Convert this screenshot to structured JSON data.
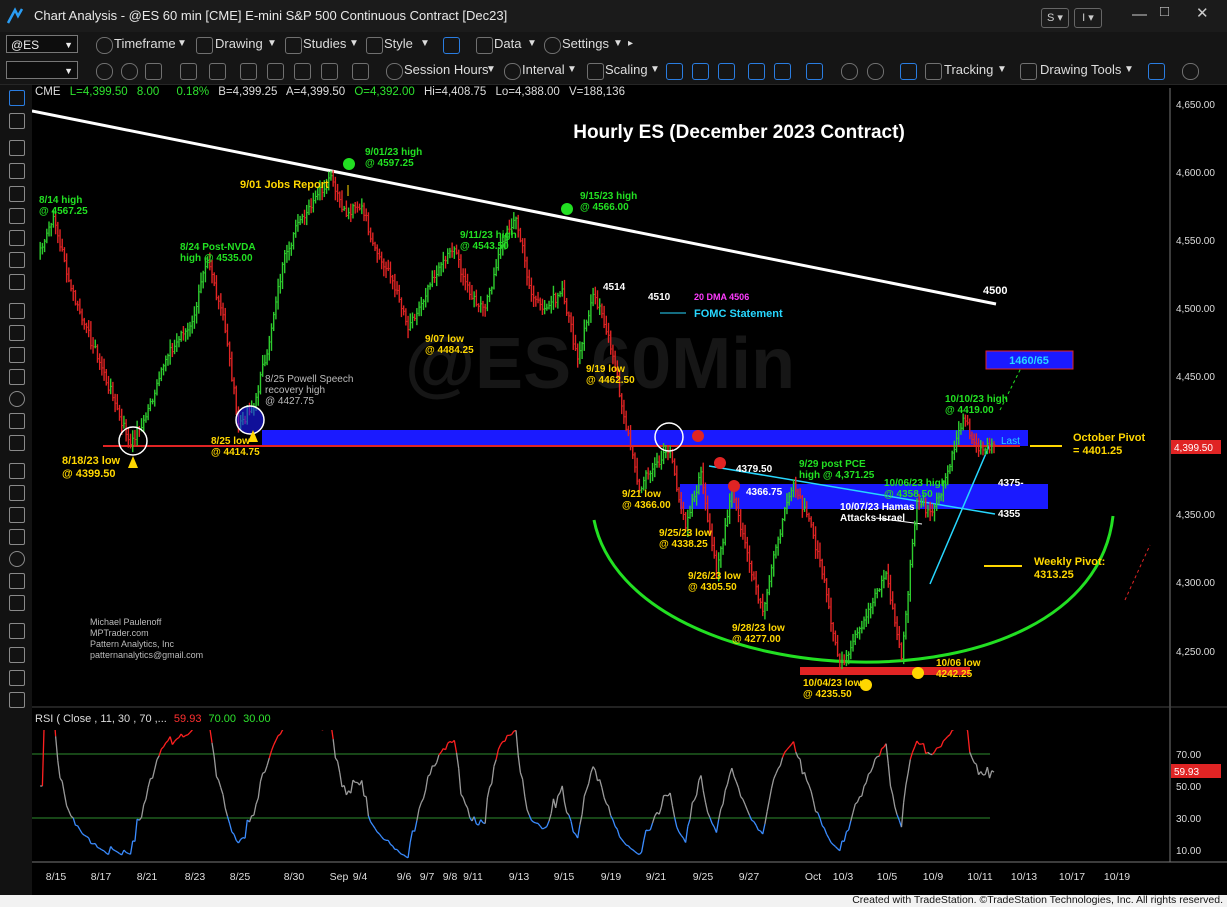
{
  "app": {
    "window_title": "Chart Analysis - @ES 60 min [CME] E-mini S&P 500 Continuous Contract [Dec23]",
    "win_buttons": [
      "S",
      "I"
    ],
    "footer": "Created with TradeStation. ©TradeStation Technologies, Inc. All rights reserved."
  },
  "toolbar1": {
    "symbol": "@ES",
    "items": [
      "Timeframe",
      "Drawing",
      "Studies",
      "Style",
      "Data",
      "Settings"
    ]
  },
  "toolbar2": {
    "items": [
      "Session Hours",
      "Interval",
      "Scaling",
      "Tracking",
      "Drawing Tools"
    ]
  },
  "quote_line": {
    "exchange": "CME",
    "last": "L=4,399.50",
    "change": "8.00",
    "pct": "0.18%",
    "bid": "B=4,399.25",
    "ask": "A=4,399.50",
    "open": "O=4,392.00",
    "high": "Hi=4,408.75",
    "low": "Lo=4,388.00",
    "volume": "V=188,136"
  },
  "colors": {
    "up_bar": "#2ecc2e",
    "down_bar": "#e02424",
    "trend_white": "#ffffff",
    "zone_blue": "#1a1aff",
    "support_red": "#e02424",
    "arc_green": "#22e022",
    "label_yellow": "#ffd700",
    "label_green": "#22e022",
    "label_cyan": "#27d7ff",
    "rsi_gray": "#9a9a9a",
    "rsi_red": "#ff2020",
    "rsi_blue": "#3b8cff"
  },
  "watermark": "@ES 60Min",
  "chart_data": {
    "type": "line",
    "title": "Hourly ES (December 2023 Contract)",
    "symbol": "@ES",
    "interval": "60 min",
    "ylim": [
      4205,
      4665
    ],
    "y_ticks": [
      "4,650.00",
      "4,600.00",
      "4,550.00",
      "4,500.00",
      "4,450.00",
      "4,350.00",
      "4,300.00",
      "4,250.00"
    ],
    "last_price_tag": "4,399.50",
    "x_ticks": [
      "8/15",
      "8/17",
      "8/21",
      "8/23",
      "8/25",
      "8/30",
      "Sep",
      "9/4",
      "9/6",
      "9/7",
      "9/8",
      "9/11",
      "9/13",
      "9/15",
      "9/19",
      "9/21",
      "9/25",
      "9/27",
      "Oct",
      "10/3",
      "10/5",
      "10/9",
      "10/11",
      "10/13",
      "10/17",
      "10/19"
    ],
    "series": [
      {
        "name": "@ES",
        "points": [
          [
            "8/14",
            4540
          ],
          [
            "8/14",
            4567.25
          ],
          [
            "8/15",
            4520
          ],
          [
            "8/15",
            4488
          ],
          [
            "8/16",
            4460
          ],
          [
            "8/17",
            4430
          ],
          [
            "8/18",
            4399.5
          ],
          [
            "8/21",
            4420
          ],
          [
            "8/21",
            4455
          ],
          [
            "8/22",
            4475
          ],
          [
            "8/23",
            4490
          ],
          [
            "8/24",
            4535
          ],
          [
            "8/24",
            4495
          ],
          [
            "8/25",
            4414.75
          ],
          [
            "8/25",
            4427.75
          ],
          [
            "8/28",
            4475
          ],
          [
            "8/29",
            4540
          ],
          [
            "8/30",
            4565
          ],
          [
            "8/31",
            4582
          ],
          [
            "9/01",
            4597.25
          ],
          [
            "9/01",
            4568
          ],
          [
            "9/5",
            4575
          ],
          [
            "9/6",
            4540
          ],
          [
            "9/6",
            4520
          ],
          [
            "9/7",
            4484.25
          ],
          [
            "9/8",
            4505
          ],
          [
            "9/11",
            4530
          ],
          [
            "9/11",
            4543.5
          ],
          [
            "9/12",
            4510
          ],
          [
            "9/13",
            4500
          ],
          [
            "9/14",
            4545
          ],
          [
            "9/15",
            4566
          ],
          [
            "9/15",
            4510
          ],
          [
            "9/18",
            4500
          ],
          [
            "9/18",
            4514
          ],
          [
            "9/19",
            4462.5
          ],
          [
            "9/20",
            4510
          ],
          [
            "9/20",
            4480
          ],
          [
            "9/21",
            4420
          ],
          [
            "9/21",
            4366
          ],
          [
            "9/22",
            4385
          ],
          [
            "9/22",
            4395
          ],
          [
            "9/25",
            4338.25
          ],
          [
            "9/25",
            4379.5
          ],
          [
            "9/26",
            4305.5
          ],
          [
            "9/26",
            4366.75
          ],
          [
            "9/27",
            4320
          ],
          [
            "9/28",
            4277
          ],
          [
            "9/28",
            4330
          ],
          [
            "9/29",
            4371.25
          ],
          [
            "10/2",
            4345
          ],
          [
            "10/3",
            4300
          ],
          [
            "10/4",
            4235.5
          ],
          [
            "10/4",
            4260
          ],
          [
            "10/5",
            4280
          ],
          [
            "10/5",
            4305
          ],
          [
            "10/6",
            4242.25
          ],
          [
            "10/6",
            4358.5
          ],
          [
            "10/9",
            4350
          ],
          [
            "10/10",
            4380
          ],
          [
            "10/10",
            4419
          ],
          [
            "10/11",
            4395
          ],
          [
            "10/11",
            4399.5
          ]
        ]
      }
    ],
    "annotations": [
      {
        "text": "8/14 high\n@ 4567.25",
        "color": "green"
      },
      {
        "text": "9/01 Jobs Report",
        "color": "yellow"
      },
      {
        "text": "9/01/23 high\n@ 4597.25",
        "color": "green"
      },
      {
        "text": "9/15/23 high\n@ 4566.00",
        "color": "green"
      },
      {
        "text": "8/24 Post-NVDA\nhigh @ 4535.00",
        "color": "green"
      },
      {
        "text": "9/11/23 high\n@ 4543.50",
        "color": "green"
      },
      {
        "text": "4514",
        "color": "white"
      },
      {
        "text": "4510",
        "color": "white"
      },
      {
        "text": "20 DMA 4506",
        "color": "magenta"
      },
      {
        "text": "FOMC Statement",
        "color": "cyan"
      },
      {
        "text": "4500",
        "color": "white"
      },
      {
        "text": "9/07 low\n@ 4484.25",
        "color": "yellow"
      },
      {
        "text": "9/19 low\n@ 4462.50",
        "color": "yellow"
      },
      {
        "text": "1460/65",
        "color": "cyan"
      },
      {
        "text": "8/25 Powell Speech\nrecovery high\n@ 4427.75",
        "color": "gray"
      },
      {
        "text": "10/10/23 high\n@ 4419.00",
        "color": "green"
      },
      {
        "text": "8/18/23 low\n@ 4399.50",
        "color": "yellow"
      },
      {
        "text": "8/25 low\n@ 4414.75",
        "color": "yellow"
      },
      {
        "text": "Last",
        "color": "cyan"
      },
      {
        "text": "October Pivot\n= 4401.25",
        "color": "yellow"
      },
      {
        "text": "4379.50",
        "color": "white"
      },
      {
        "text": "9/29 post PCE\nhigh @ 4,371.25",
        "color": "green"
      },
      {
        "text": "10/06/23 high\n@ 4358.50",
        "color": "green"
      },
      {
        "text": "4375-",
        "color": "white"
      },
      {
        "text": "4366.75",
        "color": "white"
      },
      {
        "text": "9/21 low\n@ 4366.00",
        "color": "yellow"
      },
      {
        "text": "10/07/23 Hamas\nAttacks Israel",
        "color": "white"
      },
      {
        "text": "4355",
        "color": "white"
      },
      {
        "text": "9/25/23 low\n@ 4338.25",
        "color": "yellow"
      },
      {
        "text": "Weekly Pivot:\n4313.25",
        "color": "yellow"
      },
      {
        "text": "9/26/23 low\n@ 4305.50",
        "color": "yellow"
      },
      {
        "text": "9/28/23 low\n@ 4277.00",
        "color": "yellow"
      },
      {
        "text": "10/06 low\n4242.25",
        "color": "yellow"
      },
      {
        "text": "10/04/23 low\n@ 4235.50",
        "color": "yellow"
      }
    ],
    "credit": [
      "Michael Paulenoff",
      "MPTrader.com",
      "Pattern Analytics, Inc",
      "patternanalytics@gmail.com"
    ],
    "grid": false
  },
  "rsi": {
    "label": "RSI ( Close , 11, 30 , 70 ,...",
    "value": "59.93",
    "overbought": "70.00",
    "oversold": "30.00",
    "ylim": [
      0,
      100
    ],
    "y_ticks": [
      "70.00",
      "50.00",
      "30.00",
      "10.00"
    ],
    "value_tag": "59.93"
  }
}
